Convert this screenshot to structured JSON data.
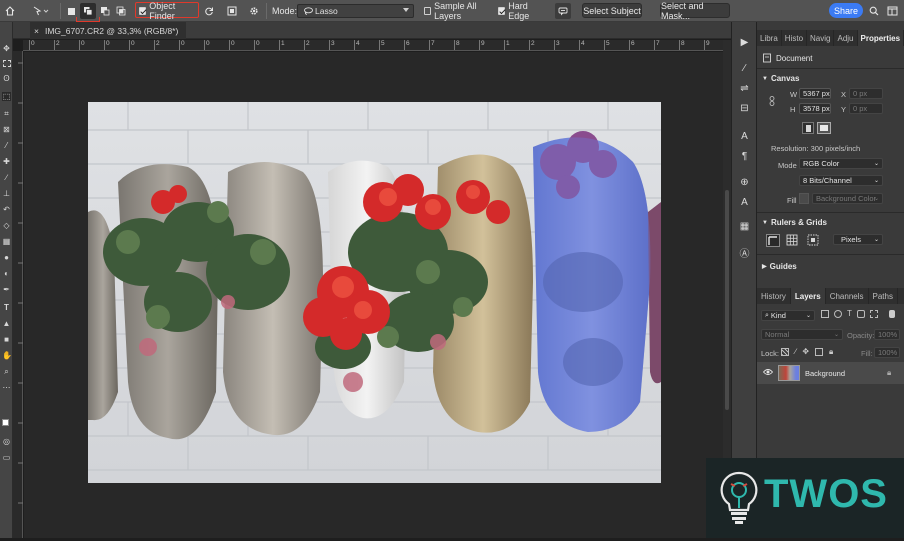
{
  "options_bar": {
    "object_finder_label": "Object Finder",
    "mode_label": "Mode:",
    "mode_value": "Lasso",
    "sample_all_layers_label": "Sample All Layers",
    "sample_all_layers_checked": false,
    "hard_edge_label": "Hard Edge",
    "hard_edge_checked": true,
    "select_subject_label": "Select Subject",
    "select_and_mask_label": "Select and Mask...",
    "share_label": "Share",
    "highlight_color": "#e0392b"
  },
  "document": {
    "tab_title": "IMG_6707.CR2 @ 33,3% (RGB/8*)",
    "close_glyph": "×"
  },
  "ruler": {
    "h_labels": [
      "0",
      "2",
      "0",
      "0",
      "0",
      "2",
      "0",
      "0",
      "0",
      "0",
      "1",
      "2",
      "3",
      "4",
      "5",
      "6",
      "7",
      "8",
      "9",
      "1",
      "2",
      "3",
      "4",
      "5",
      "6",
      "7",
      "8",
      "9"
    ]
  },
  "panels": {
    "top_tabs": [
      "Libra",
      "Histo",
      "Navig",
      "Adju",
      "Properties"
    ],
    "active_top_tab": "Properties",
    "document_label": "Document",
    "canvas": {
      "title": "Canvas",
      "w_label": "W",
      "w_value": "5367 px",
      "h_label": "H",
      "h_value": "3578 px",
      "x_label": "X",
      "x_value": "0 px",
      "y_label": "Y",
      "y_value": "0 px",
      "resolution": "Resolution: 300 pixels/inch",
      "mode_label": "Mode",
      "mode_value": "RGB Color",
      "depth_value": "8 Bits/Channel",
      "fill_label": "Fill",
      "fill_value": "Background Color"
    },
    "rulers_grids": {
      "title": "Rulers & Grids",
      "unit_value": "Pixels"
    },
    "guides": {
      "title": "Guides"
    },
    "layer_tabs": [
      "History",
      "Layers",
      "Channels",
      "Paths"
    ],
    "active_layer_tab": "Layers",
    "layers": {
      "kind_label": "Kind",
      "blend_mode": "Normal",
      "opacity_label": "Opacity:",
      "opacity_value": "100%",
      "lock_label": "Lock:",
      "fill_label": "Fill:",
      "fill_value": "100%",
      "layer_name": "Background"
    }
  },
  "watermark": {
    "text": "TWOS",
    "color": "#2fb8ad"
  },
  "icons": [
    "home-icon",
    "tool-preset-icon",
    "new-selection-icon",
    "add-selection-icon",
    "subtract-selection-icon",
    "intersect-selection-icon",
    "refresh-icon",
    "transform-icon",
    "gear-icon",
    "lasso-icon",
    "collaborate-icon",
    "search-icon",
    "workspace-icon"
  ]
}
